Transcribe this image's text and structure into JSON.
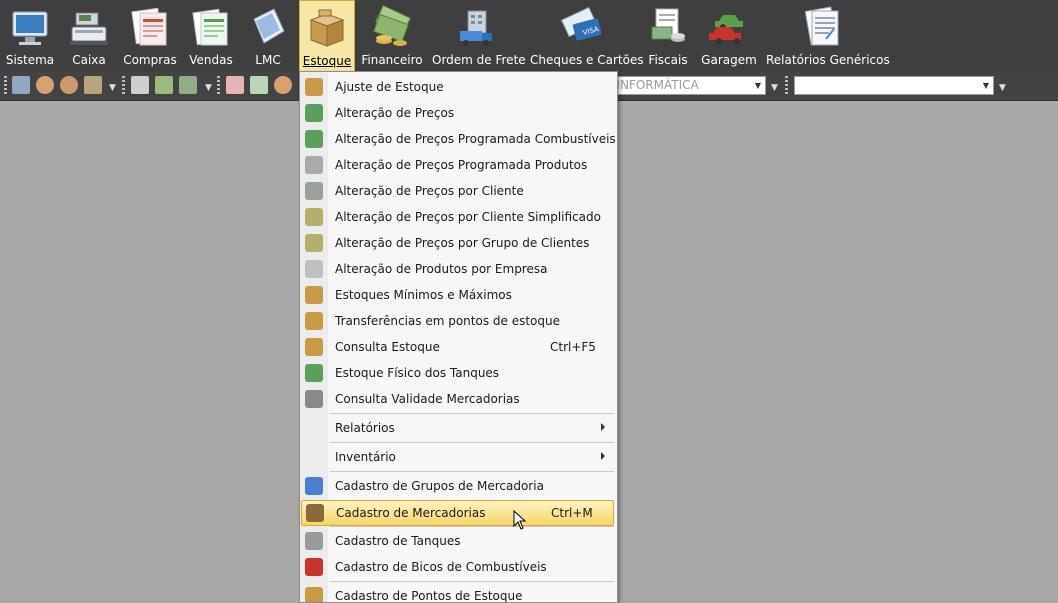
{
  "ribbon": {
    "items": [
      {
        "label": "Sistema",
        "accent": "#3a7ebf",
        "icon": "monitor-icon"
      },
      {
        "label": "Caixa",
        "accent": "#9aa8b3",
        "icon": "cash-register-icon"
      },
      {
        "label": "Compras",
        "accent": "#d24b3c",
        "icon": "invoice-icon"
      },
      {
        "label": "Vendas",
        "accent": "#4aa05a",
        "icon": "sales-sheet-icon"
      },
      {
        "label": "LMC",
        "accent": "#5c8ecb",
        "icon": "book-icon"
      },
      {
        "label": "Estoque",
        "accent": "#c79b4f",
        "icon": "box-icon"
      },
      {
        "label": "Financeiro",
        "accent": "#6c9a4c",
        "icon": "money-icon"
      },
      {
        "label": "Ordem de Frete",
        "accent": "#4a8ad8",
        "icon": "truck-icon"
      },
      {
        "label": "Cheques e Cartões",
        "accent": "#7aa6c7",
        "icon": "card-icon"
      },
      {
        "label": "Fiscais",
        "accent": "#8ab48a",
        "icon": "fiscal-icon"
      },
      {
        "label": "Garagem",
        "accent": "#c8342c",
        "icon": "cars-icon"
      },
      {
        "label": "Relatórios Genéricos",
        "accent": "#dfe5ee",
        "icon": "report-icon"
      }
    ]
  },
  "toolbar": {
    "company_combo": "S INFORMÁTICA",
    "second_combo": ""
  },
  "menu": {
    "items": [
      {
        "label": "Ajuste de Estoque",
        "shortcut": "",
        "icon": "boxes-icon",
        "color": "#c89a44"
      },
      {
        "label": "Alteração de Preços",
        "shortcut": "",
        "icon": "price-tag-icon",
        "color": "#5a9f5a"
      },
      {
        "label": "Alteração de Preços Programada Combustíveis",
        "shortcut": "",
        "icon": "fuel-price-icon",
        "color": "#5a9f5a"
      },
      {
        "label": "Alteração de Preços Programada Produtos",
        "shortcut": "",
        "icon": "schedule-icon",
        "color": "#aaaaaa"
      },
      {
        "label": "Alteração de Preços por Cliente",
        "shortcut": "",
        "icon": "client-price-icon",
        "color": "#9aa09a"
      },
      {
        "label": "Alteração de Preços por Cliente Simplificado",
        "shortcut": "",
        "icon": "client-price-simple-icon",
        "color": "#b4b06a"
      },
      {
        "label": "Alteração de Preços por Grupo de Clientes",
        "shortcut": "",
        "icon": "group-price-icon",
        "color": "#b4b06a"
      },
      {
        "label": "Alteração de Produtos por Empresa",
        "shortcut": "",
        "icon": "company-products-icon",
        "color": "#c0c0c0"
      },
      {
        "label": "Estoques Mínimos e Máximos",
        "shortcut": "",
        "icon": "min-max-icon",
        "color": "#c89a44"
      },
      {
        "label": "Transferências em pontos de estoque",
        "shortcut": "",
        "icon": "transfer-icon",
        "color": "#c89a44"
      },
      {
        "label": "Consulta Estoque",
        "shortcut": "Ctrl+F5",
        "icon": "stock-query-icon",
        "color": "#c89a44"
      },
      {
        "label": "Estoque Físico dos Tanques",
        "shortcut": "",
        "icon": "tank-icon",
        "color": "#5a9f5a"
      },
      {
        "label": "Consulta Validade Mercadorias",
        "shortcut": "",
        "icon": "safe-icon",
        "color": "#8a8a8a"
      },
      {
        "label": "Relatórios",
        "shortcut": "",
        "icon": "",
        "color": ""
      },
      {
        "label": "Inventário",
        "shortcut": "",
        "icon": "",
        "color": ""
      },
      {
        "label": "Cadastro de Grupos de Mercadoria",
        "shortcut": "",
        "icon": "groups-icon",
        "color": "#4a7ed0"
      },
      {
        "label": "Cadastro de Mercadorias",
        "shortcut": "Ctrl+M",
        "icon": "merchandise-icon",
        "color": "#8a6a3a"
      },
      {
        "label": "Cadastro de Tanques",
        "shortcut": "",
        "icon": "tanks-register-icon",
        "color": "#9a9a9a"
      },
      {
        "label": "Cadastro de Bicos de Combustíveis",
        "shortcut": "",
        "icon": "fuel-nozzle-icon",
        "color": "#c8342c"
      },
      {
        "label": "Cadastro de Pontos de Estoque",
        "shortcut": "",
        "icon": "stock-points-icon",
        "color": "#c89a44"
      }
    ]
  }
}
